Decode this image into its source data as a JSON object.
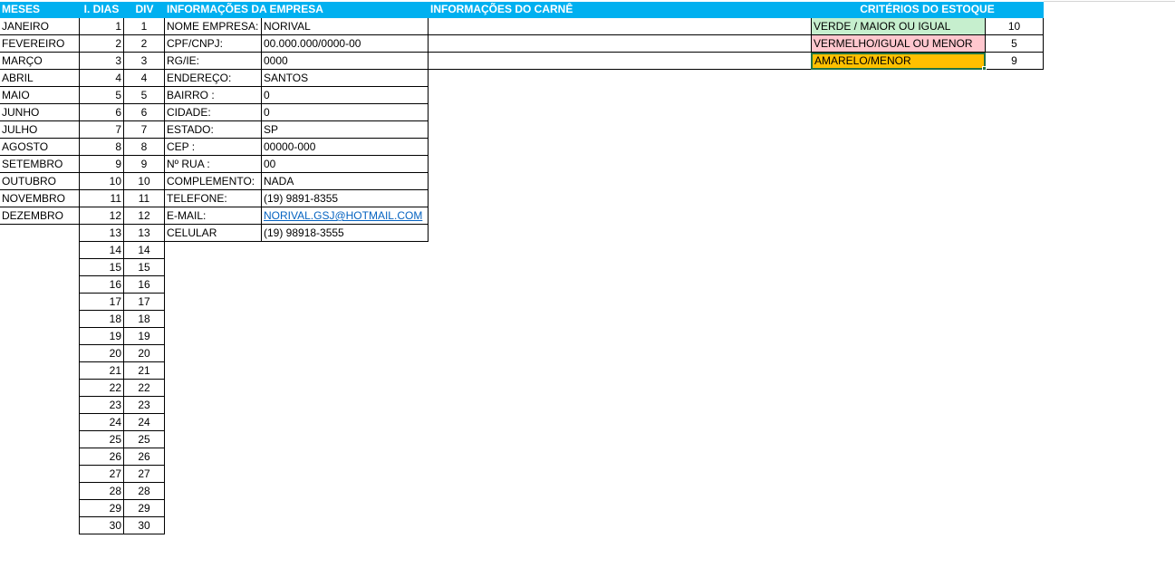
{
  "headers": {
    "meses": "MESES",
    "dias": "I. DIAS",
    "div": "DIV",
    "empresa": "INFORMAÇÕES DA EMPRESA",
    "carne": "INFORMAÇÕES DO CARNÊ",
    "criterios": "CRITÉRIOS DO ESTOQUE"
  },
  "meses": [
    "JANEIRO",
    "FEVEREIRO",
    "MARÇO",
    "ABRIL",
    "MAIO",
    "JUNHO",
    "JULHO",
    "AGOSTO",
    "SETEMBRO",
    "OUTUBRO",
    "NOVEMBRO",
    "DEZEMBRO"
  ],
  "dias": [
    1,
    2,
    3,
    4,
    5,
    6,
    7,
    8,
    9,
    10,
    11,
    12,
    13,
    14,
    15,
    16,
    17,
    18,
    19,
    20,
    21,
    22,
    23,
    24,
    25,
    26,
    27,
    28,
    29,
    30
  ],
  "div": [
    1,
    2,
    3,
    4,
    5,
    6,
    7,
    8,
    9,
    10,
    11,
    12,
    13,
    14,
    15,
    16,
    17,
    18,
    19,
    20,
    21,
    22,
    23,
    24,
    25,
    26,
    27,
    28,
    29,
    30
  ],
  "empresa": [
    {
      "label": "NOME EMPRESA:",
      "value": "NORIVAL"
    },
    {
      "label": "CPF/CNPJ:",
      "value": "00.000.000/0000-00"
    },
    {
      "label": "RG/IE:",
      "value": "0000"
    },
    {
      "label": "ENDEREÇO:",
      "value": "SANTOS"
    },
    {
      "label": "BAIRRO :",
      "value": "0"
    },
    {
      "label": "CIDADE:",
      "value": "0"
    },
    {
      "label": "ESTADO:",
      "value": "SP"
    },
    {
      "label": "CEP :",
      "value": "00000-000"
    },
    {
      "label": "Nº RUA :",
      "value": "00"
    },
    {
      "label": "COMPLEMENTO:",
      "value": "NADA"
    },
    {
      "label": "TELEFONE:",
      "value": "(19) 9891-8355"
    },
    {
      "label": "E-MAIL:",
      "value": "NORIVAL.GSJ@HOTMAIL.COM",
      "link": true
    },
    {
      "label": "CELULAR",
      "value": "(19) 98918-3555"
    }
  ],
  "criterios": [
    {
      "label": "VERDE / MAIOR OU IGUAL",
      "value": "10",
      "color": "#c6efce"
    },
    {
      "label": "VERMELHO/IGUAL OU MENOR",
      "value": "5",
      "color": "#ffc7ce"
    },
    {
      "label": "AMARELO/MENOR",
      "value": "9",
      "color": "#ffc000"
    }
  ],
  "colors": {
    "header_bg": "#00b0f0",
    "header_text": "#ffffff",
    "link": "#0563c1",
    "selection": "#217346"
  }
}
